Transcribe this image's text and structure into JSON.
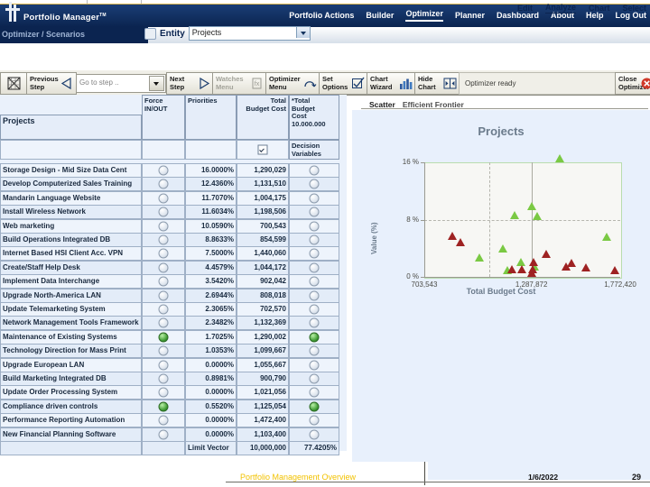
{
  "app": {
    "product_name": "Portfolio Manager",
    "trademark": "TM",
    "breadcrumb": "Optimizer / Scenarios"
  },
  "nav": {
    "items": [
      {
        "label": "Portfolio Actions",
        "active": false
      },
      {
        "label": "Builder",
        "active": false
      },
      {
        "label": "Optimizer",
        "active": true
      },
      {
        "label": "Planner",
        "active": false
      },
      {
        "label": "Dashboard",
        "active": false
      },
      {
        "label": "About",
        "active": false
      },
      {
        "label": "Help",
        "active": false
      },
      {
        "label": "Log Out",
        "active": false
      }
    ]
  },
  "subnav": {
    "items": [
      {
        "label": "Edit",
        "active": false
      },
      {
        "label": "Analyze",
        "active": true
      },
      {
        "label": "Chart",
        "active": false
      },
      {
        "label": "Select",
        "active": false
      }
    ]
  },
  "entity": {
    "label": "Entity",
    "value": "Projects",
    "icon": "entity-icon"
  },
  "toolbar": {
    "buttons": [
      {
        "name": "grid-icon-button",
        "line1": "",
        "line2": "",
        "icon": "grid-icon",
        "disabled": false
      },
      {
        "name": "previous-step",
        "line1": "Previous",
        "line2": "Step",
        "icon": "triangle-left-icon",
        "disabled": false
      },
      {
        "name": "next-step",
        "line1": "Next",
        "line2": "Step",
        "icon": "triangle-right-icon",
        "disabled": false
      },
      {
        "name": "watches-menu",
        "line1": "Watches",
        "line2": "Menu",
        "icon": "watches-icon",
        "disabled": true
      },
      {
        "name": "optimizer-menu",
        "line1": "Optimizer",
        "line2": "Menu",
        "icon": "optimizer-icon",
        "disabled": false
      },
      {
        "name": "set-options",
        "line1": "Set",
        "line2": "Options",
        "icon": "checkbox-icon",
        "disabled": false
      },
      {
        "name": "chart-wizard",
        "line1": "Chart",
        "line2": "Wizard",
        "icon": "bar-chart-icon",
        "disabled": false
      },
      {
        "name": "hide-chart",
        "line1": "Hide",
        "line2": "Chart",
        "icon": "hide-chart-icon",
        "disabled": false
      },
      {
        "name": "close-optimizer",
        "line1": "Close",
        "line2": "Optimizer",
        "icon": "close-icon",
        "disabled": false
      }
    ],
    "goto_step_placeholder": "Go to step ..",
    "status": "Optimizer ready"
  },
  "chart_tabs": [
    {
      "label": "Scatter",
      "active": true
    },
    {
      "label": "Efficient Frontier",
      "active": false
    }
  ],
  "grid": {
    "headers": {
      "projects": "Projects",
      "force": "Force\nIN/OUT",
      "priorities": "Priorities",
      "total_budget_cost": "Total\nBudget Cost",
      "limit_col": "*Total\nBudget\nCost\n10.000.000"
    },
    "decision_row": {
      "label": "Decision\nVariables",
      "checkbox_checked": true
    },
    "rows": [
      {
        "project": "Storage Design - Mid Size Data Cent",
        "force": "off",
        "priority": "16.0000%",
        "cost": "1,290,029",
        "decision": "off"
      },
      {
        "project": "Develop Computerized Sales Training",
        "force": "off",
        "priority": "12.4360%",
        "cost": "1,131,510",
        "decision": "off"
      },
      {
        "project": "Mandarin Language Website",
        "force": "off",
        "priority": "11.7070%",
        "cost": "1,004,175",
        "decision": "off"
      },
      {
        "project": "Install Wireless Network",
        "force": "off",
        "priority": "11.6034%",
        "cost": "1,198,506",
        "decision": "off"
      },
      {
        "project": "Web marketing",
        "force": "off",
        "priority": "10.0590%",
        "cost": "700,543",
        "decision": "off"
      },
      {
        "project": "Build Operations Integrated DB",
        "force": "off",
        "priority": "8.8633%",
        "cost": "854,599",
        "decision": "off"
      },
      {
        "project": "Internet Based HSI Client Acc. VPN",
        "force": "off",
        "priority": "7.5000%",
        "cost": "1,440,060",
        "decision": "off"
      },
      {
        "project": "Create/Staff Help Desk",
        "force": "off",
        "priority": "4.4579%",
        "cost": "1,044,172",
        "decision": "off"
      },
      {
        "project": "Implement Data Interchange",
        "force": "off",
        "priority": "3.5420%",
        "cost": "902,042",
        "decision": "off"
      },
      {
        "project": "Upgrade North-America LAN",
        "force": "off",
        "priority": "2.6944%",
        "cost": "808,018",
        "decision": "off"
      },
      {
        "project": "Update Telemarketing System",
        "force": "off",
        "priority": "2.3065%",
        "cost": "702,570",
        "decision": "off"
      },
      {
        "project": "Network Management Tools Framework",
        "force": "off",
        "priority": "2.3482%",
        "cost": "1,132,369",
        "decision": "off"
      },
      {
        "project": "Maintenance of Existing Systems",
        "force": "on",
        "priority": "1.7025%",
        "cost": "1,290,002",
        "decision": "on"
      },
      {
        "project": "Technology Direction for Mass Print",
        "force": "off",
        "priority": "1.0353%",
        "cost": "1,099,667",
        "decision": "off"
      },
      {
        "project": "Upgrade European LAN",
        "force": "off",
        "priority": "0.0000%",
        "cost": "1,055,667",
        "decision": "off"
      },
      {
        "project": "Build Marketing Integrated DB",
        "force": "off",
        "priority": "0.8981%",
        "cost": "900,790",
        "decision": "off"
      },
      {
        "project": "Update Order Processing System",
        "force": "off",
        "priority": "0.0000%",
        "cost": "1,021,056",
        "decision": "off"
      },
      {
        "project": "Compliance driven controls",
        "force": "on",
        "priority": "0.5520%",
        "cost": "1,125,054",
        "decision": "on"
      },
      {
        "project": "Performance Reporting Automation",
        "force": "off",
        "priority": "0.0000%",
        "cost": "1,472,400",
        "decision": "off"
      },
      {
        "project": "New Financial Planning Software",
        "force": "off",
        "priority": "0.0000%",
        "cost": "1,103,400",
        "decision": "off"
      }
    ],
    "footer": {
      "label": "Limit Vector",
      "total": "10,000,000",
      "percent": "77.4205%"
    }
  },
  "chart_data": {
    "type": "scatter",
    "title": "Projects",
    "xlabel": "Total Budget Cost",
    "ylabel": "Value (%)",
    "xlim": [
      703543,
      1772420
    ],
    "ylim": [
      0,
      16
    ],
    "xticks": [
      "703,543",
      "1,287,872",
      "1,772,420"
    ],
    "yticks": [
      "0 %",
      "8 %",
      "16 %"
    ],
    "grid": true,
    "legend": "none",
    "series": [
      {
        "name": "Selected",
        "color": "#7ac943",
        "points": [
          {
            "x": 1440060,
            "y": 16.0
          },
          {
            "x": 1290029,
            "y": 9.3
          },
          {
            "x": 1198506,
            "y": 8.1
          },
          {
            "x": 1317000,
            "y": 8.0
          },
          {
            "x": 1004175,
            "y": 2.1
          },
          {
            "x": 1131510,
            "y": 3.4
          },
          {
            "x": 1232000,
            "y": 1.45
          },
          {
            "x": 1155000,
            "y": 0.35
          },
          {
            "x": 1700000,
            "y": 5.1
          },
          {
            "x": 1303000,
            "y": 0.9
          }
        ]
      },
      {
        "name": "Not selected",
        "color": "#9e2222",
        "points": [
          {
            "x": 854599,
            "y": 5.2
          },
          {
            "x": 902042,
            "y": 4.3
          },
          {
            "x": 1370000,
            "y": 2.6
          },
          {
            "x": 1300000,
            "y": 1.5
          },
          {
            "x": 1508000,
            "y": 1.4
          },
          {
            "x": 1479000,
            "y": 0.85
          },
          {
            "x": 1584000,
            "y": 0.8
          },
          {
            "x": 1180000,
            "y": 0.45
          },
          {
            "x": 1236000,
            "y": 0.45
          },
          {
            "x": 1297000,
            "y": 0.45
          },
          {
            "x": 1287872,
            "y": 0.0
          },
          {
            "x": 1745000,
            "y": 0.35
          }
        ]
      }
    ]
  },
  "footer": {
    "title": "Portfolio Management Overview",
    "date": "1/6/2022",
    "page": "29"
  }
}
